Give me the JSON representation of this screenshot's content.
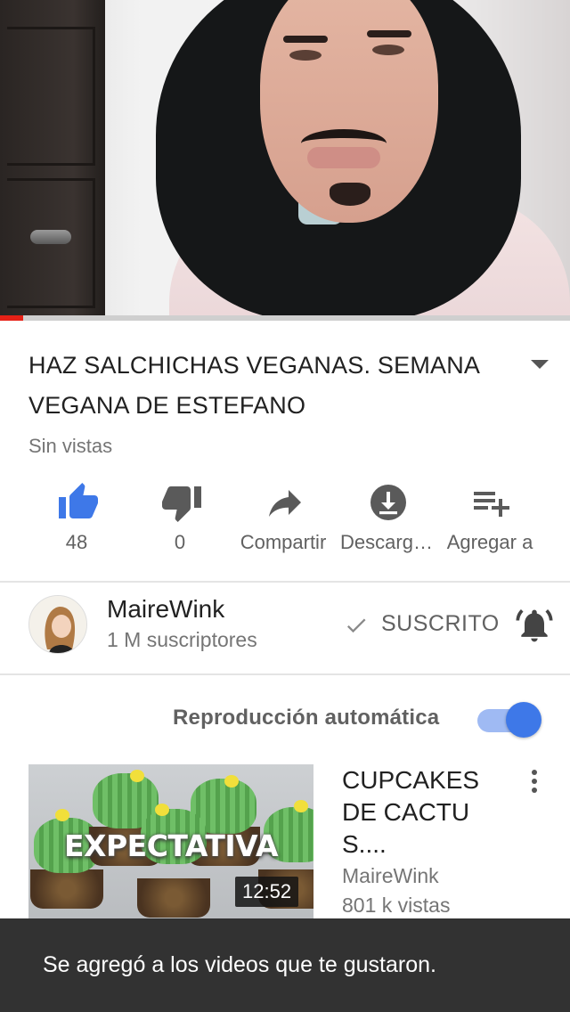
{
  "video": {
    "title": "HAZ SALCHICHAS VEGANAS. SEMANA VEGANA DE ESTEFANO",
    "views": "Sin vistas",
    "progress_fraction": 0.04
  },
  "actions": {
    "like": {
      "icon": "thumb-up-icon",
      "label": "48",
      "active_color": "#3e78e8"
    },
    "dislike": {
      "icon": "thumb-down-icon",
      "label": "0"
    },
    "share": {
      "icon": "share-icon",
      "label": "Compartir"
    },
    "download": {
      "icon": "download-icon",
      "label": "Descarg…"
    },
    "add": {
      "icon": "playlist-add-icon",
      "label": "Agregar a"
    }
  },
  "channel": {
    "name": "MaireWink",
    "subscribers": "1 M suscriptores",
    "subscribe_label": "SUSCRITO",
    "avatar_text": "Maire Wink"
  },
  "autoplay": {
    "label": "Reproducción automática",
    "enabled": true
  },
  "next_video": {
    "title": "CUPCAKES DE CACTUS....",
    "channel": "MaireWink",
    "views": "801 k vistas",
    "duration": "12:52",
    "thumbnail_text": "EXPECTATIVA"
  },
  "snackbar": {
    "message": "Se agregó a los videos que te gustaron."
  },
  "colors": {
    "accent_blue": "#3e78e8",
    "progress_red": "#e62117",
    "snackbar_bg": "#323232"
  }
}
